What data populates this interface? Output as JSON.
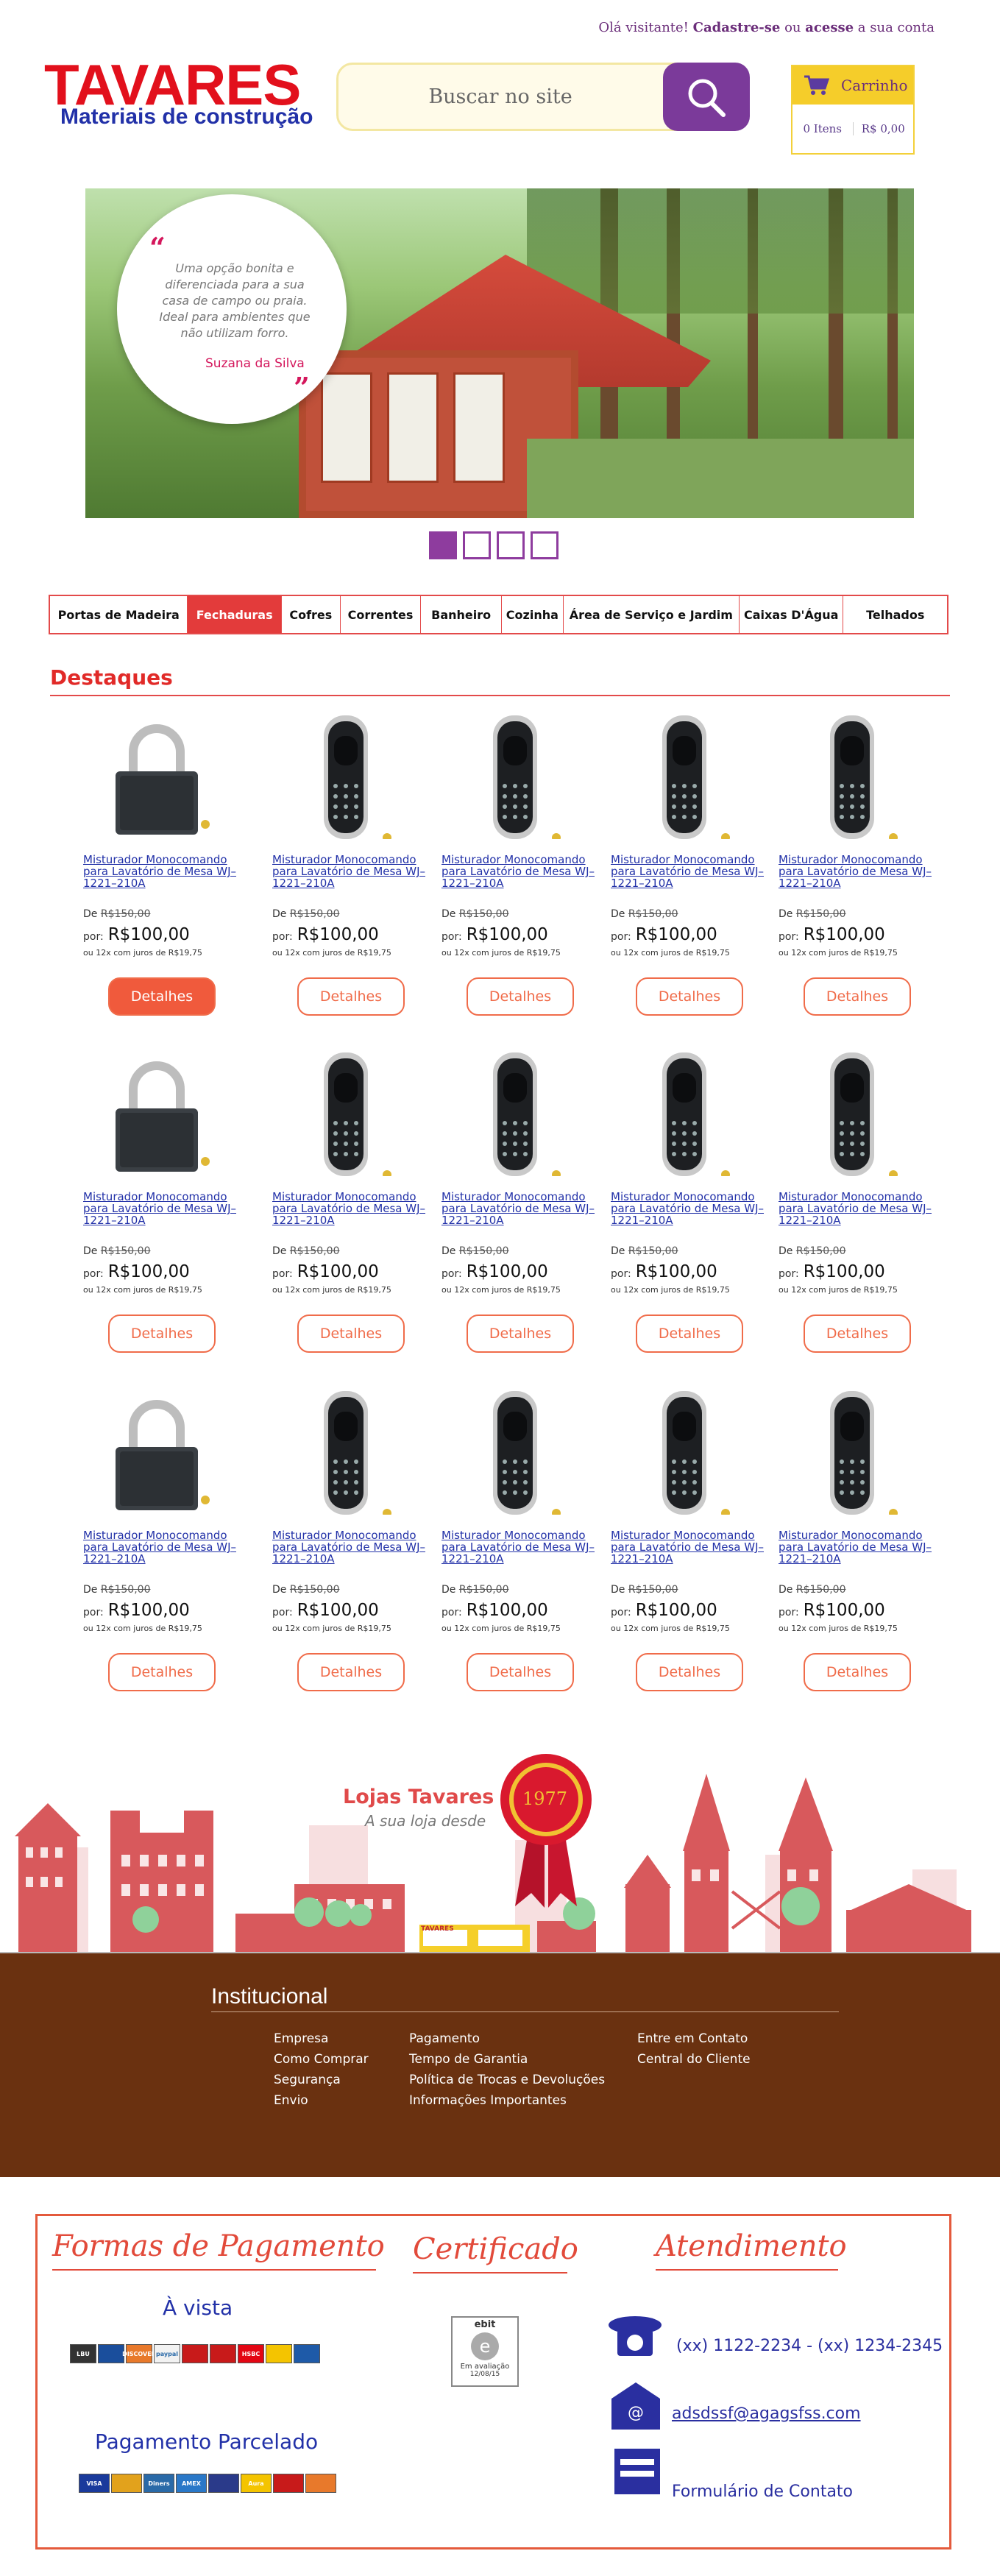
{
  "header": {
    "greeting": "Olá visitante!",
    "signup": "Cadastre-se",
    "or": "ou",
    "login": "acesse",
    "tail": "a sua conta",
    "logo_main": "TAVARES",
    "logo_sub": "Materiais de construção",
    "search_placeholder": "Buscar no site",
    "cart_label": "Carrinho",
    "cart_items": "0 Itens",
    "cart_total": "R$ 0,00"
  },
  "banner": {
    "quote": "Uma opção bonita e diferenciada para a sua casa de campo ou praia. Ideal para ambientes que não utilizam forro.",
    "author": "Suzana da Silva",
    "slides": [
      true,
      false,
      false,
      false
    ]
  },
  "categories": [
    {
      "label": "Portas de Madeira",
      "active": false
    },
    {
      "label": "Fechaduras",
      "active": true
    },
    {
      "label": "Cofres",
      "active": false
    },
    {
      "label": "Correntes",
      "active": false
    },
    {
      "label": "Banheiro",
      "active": false
    },
    {
      "label": "Cozinha",
      "active": false
    },
    {
      "label": "Área de Serviço e Jardim",
      "active": false
    },
    {
      "label": "Caixas D'Água",
      "active": false
    },
    {
      "label": "Telhados",
      "active": false
    }
  ],
  "destaques": {
    "title": "Destaques",
    "products": [
      {
        "kind": "padlock",
        "name": "Misturador Monocomando para Lavatório de Mesa WJ–1221–210A",
        "old_label": "De",
        "old_price": "R$150,00",
        "new_label": "por:",
        "new_price": "R$100,00",
        "installments": "ou 12x com juros de R$19,75",
        "button": "Detalhes",
        "highlighted": true
      },
      {
        "kind": "digital",
        "name": "Misturador Monocomando para Lavatório de Mesa WJ–1221–210A",
        "old_label": "De",
        "old_price": "R$150,00",
        "new_label": "por:",
        "new_price": "R$100,00",
        "installments": "ou 12x com juros de R$19,75",
        "button": "Detalhes",
        "highlighted": false
      },
      {
        "kind": "digital",
        "name": "Misturador Monocomando para Lavatório de Mesa WJ–1221–210A",
        "old_label": "De",
        "old_price": "R$150,00",
        "new_label": "por:",
        "new_price": "R$100,00",
        "installments": "ou 12x com juros de R$19,75",
        "button": "Detalhes",
        "highlighted": false
      },
      {
        "kind": "digital",
        "name": "Misturador Monocomando para Lavatório de Mesa WJ–1221–210A",
        "old_label": "De",
        "old_price": "R$150,00",
        "new_label": "por:",
        "new_price": "R$100,00",
        "installments": "ou 12x com juros de R$19,75",
        "button": "Detalhes",
        "highlighted": false
      },
      {
        "kind": "digital",
        "name": "Misturador Monocomando para Lavatório de Mesa WJ–1221–210A",
        "old_label": "De",
        "old_price": "R$150,00",
        "new_label": "por:",
        "new_price": "R$100,00",
        "installments": "ou 12x com juros de R$19,75",
        "button": "Detalhes",
        "highlighted": false
      },
      {
        "kind": "padlock",
        "name": "Misturador Monocomando para Lavatório de Mesa WJ–1221–210A",
        "old_label": "De",
        "old_price": "R$150,00",
        "new_label": "por:",
        "new_price": "R$100,00",
        "installments": "ou 12x com juros de R$19,75",
        "button": "Detalhes",
        "highlighted": false
      },
      {
        "kind": "digital",
        "name": "Misturador Monocomando para Lavatório de Mesa WJ–1221–210A",
        "old_label": "De",
        "old_price": "R$150,00",
        "new_label": "por:",
        "new_price": "R$100,00",
        "installments": "ou 12x com juros de R$19,75",
        "button": "Detalhes",
        "highlighted": false
      },
      {
        "kind": "digital",
        "name": "Misturador Monocomando para Lavatório de Mesa WJ–1221–210A",
        "old_label": "De",
        "old_price": "R$150,00",
        "new_label": "por:",
        "new_price": "R$100,00",
        "installments": "ou 12x com juros de R$19,75",
        "button": "Detalhes",
        "highlighted": false
      },
      {
        "kind": "digital",
        "name": "Misturador Monocomando para Lavatório de Mesa WJ–1221–210A",
        "old_label": "De",
        "old_price": "R$150,00",
        "new_label": "por:",
        "new_price": "R$100,00",
        "installments": "ou 12x com juros de R$19,75",
        "button": "Detalhes",
        "highlighted": false
      },
      {
        "kind": "digital",
        "name": "Misturador Monocomando para Lavatório de Mesa WJ–1221–210A",
        "old_label": "De",
        "old_price": "R$150,00",
        "new_label": "por:",
        "new_price": "R$100,00",
        "installments": "ou 12x com juros de R$19,75",
        "button": "Detalhes",
        "highlighted": false
      },
      {
        "kind": "padlock",
        "name": "Misturador Monocomando para Lavatório de Mesa WJ–1221–210A",
        "old_label": "De",
        "old_price": "R$150,00",
        "new_label": "por:",
        "new_price": "R$100,00",
        "installments": "ou 12x com juros de R$19,75",
        "button": "Detalhes",
        "highlighted": false
      },
      {
        "kind": "digital",
        "name": "Misturador Monocomando para Lavatório de Mesa WJ–1221–210A",
        "old_label": "De",
        "old_price": "R$150,00",
        "new_label": "por:",
        "new_price": "R$100,00",
        "installments": "ou 12x com juros de R$19,75",
        "button": "Detalhes",
        "highlighted": false
      },
      {
        "kind": "digital",
        "name": "Misturador Monocomando para Lavatório de Mesa WJ–1221–210A",
        "old_label": "De",
        "old_price": "R$150,00",
        "new_label": "por:",
        "new_price": "R$100,00",
        "installments": "ou 12x com juros de R$19,75",
        "button": "Detalhes",
        "highlighted": false
      },
      {
        "kind": "digital",
        "name": "Misturador Monocomando para Lavatório de Mesa WJ–1221–210A",
        "old_label": "De",
        "old_price": "R$150,00",
        "new_label": "por:",
        "new_price": "R$100,00",
        "installments": "ou 12x com juros de R$19,75",
        "button": "Detalhes",
        "highlighted": false
      },
      {
        "kind": "digital",
        "name": "Misturador Monocomando para Lavatório de Mesa WJ–1221–210A",
        "old_label": "De",
        "old_price": "R$150,00",
        "new_label": "por:",
        "new_price": "R$100,00",
        "installments": "ou 12x com juros de R$19,75",
        "button": "Detalhes",
        "highlighted": false
      }
    ]
  },
  "stores": {
    "title": "Lojas Tavares",
    "tagline": "A sua loja desde",
    "year": "1977",
    "shop_sign": "TAVARES"
  },
  "footer": {
    "title": "Institucional",
    "col1": [
      "Empresa",
      "Como Comprar",
      "Segurança",
      "Envio"
    ],
    "col2": [
      "Pagamento",
      "Tempo de Garantia",
      "Política de Trocas e Devoluções",
      "Informações Importantes"
    ],
    "col3": [
      "Entre em Contato",
      "Central do Cliente"
    ]
  },
  "bottom": {
    "payment_title": "Formas de Pagamento",
    "cash_label": "À vista",
    "cash_methods": [
      "LBU",
      "",
      "DISCOVER",
      "paypal",
      "",
      "",
      "HSBC",
      "",
      ""
    ],
    "installment_label": "Pagamento Parcelado",
    "card_methods": [
      "VISA",
      "",
      "Diners",
      "AMEX",
      "",
      "Aura",
      "",
      ""
    ],
    "cert_title": "Certificado",
    "cert_badge_top": "ebit",
    "cert_badge_mid": "Em avaliação",
    "cert_badge_date": "12/08/15",
    "contact_title": "Atendimento",
    "phone": "(xx) 1122-2234 - (xx) 1234-2345",
    "email": "adsdssf@agagsfss.com",
    "form": "Formulário de Contato"
  },
  "colors": {
    "brand_red": "#e2101c",
    "brand_blue": "#2231a8",
    "accent_purple": "#7b3a9a",
    "accent_orange": "#f06c4a",
    "footer_brown": "#6a3110"
  }
}
